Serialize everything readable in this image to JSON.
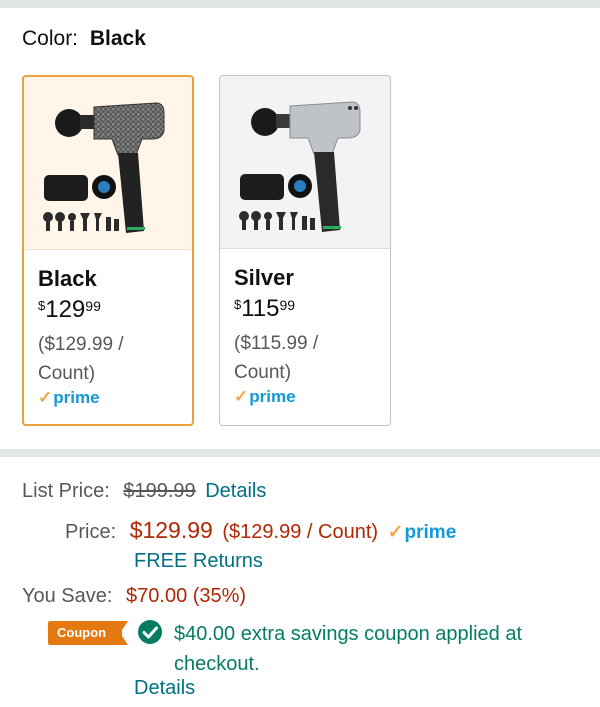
{
  "color_selector": {
    "label": "Color:",
    "selected": "Black",
    "options": [
      {
        "name": "Black",
        "currency": "$",
        "price_whole": "129",
        "price_cents": "99",
        "unit_line1": "($129.99 /",
        "unit_line2": "Count)",
        "prime": "prime",
        "selected": true
      },
      {
        "name": "Silver",
        "currency": "$",
        "price_whole": "115",
        "price_cents": "99",
        "unit_line1": "($115.99 /",
        "unit_line2": "Count)",
        "prime": "prime",
        "selected": false
      }
    ]
  },
  "pricing": {
    "list_price_label": "List Price:",
    "list_price": "$199.99",
    "list_price_details": "Details",
    "price_label": "Price:",
    "price": "$129.99",
    "price_per_unit": "($129.99 / Count)",
    "prime": "prime",
    "free_returns": "FREE Returns",
    "you_save_label": "You Save:",
    "you_save": "$70.00 (35%)"
  },
  "coupon": {
    "badge": "Coupon",
    "text": "$40.00 extra savings coupon applied at checkout.",
    "details": "Details"
  },
  "colors": {
    "price_red": "#b12704",
    "link_teal": "#007185",
    "coupon_green": "#067d62",
    "coupon_orange": "#e47911",
    "prime_blue": "#1399d6",
    "selected_border": "#e6a23c"
  }
}
